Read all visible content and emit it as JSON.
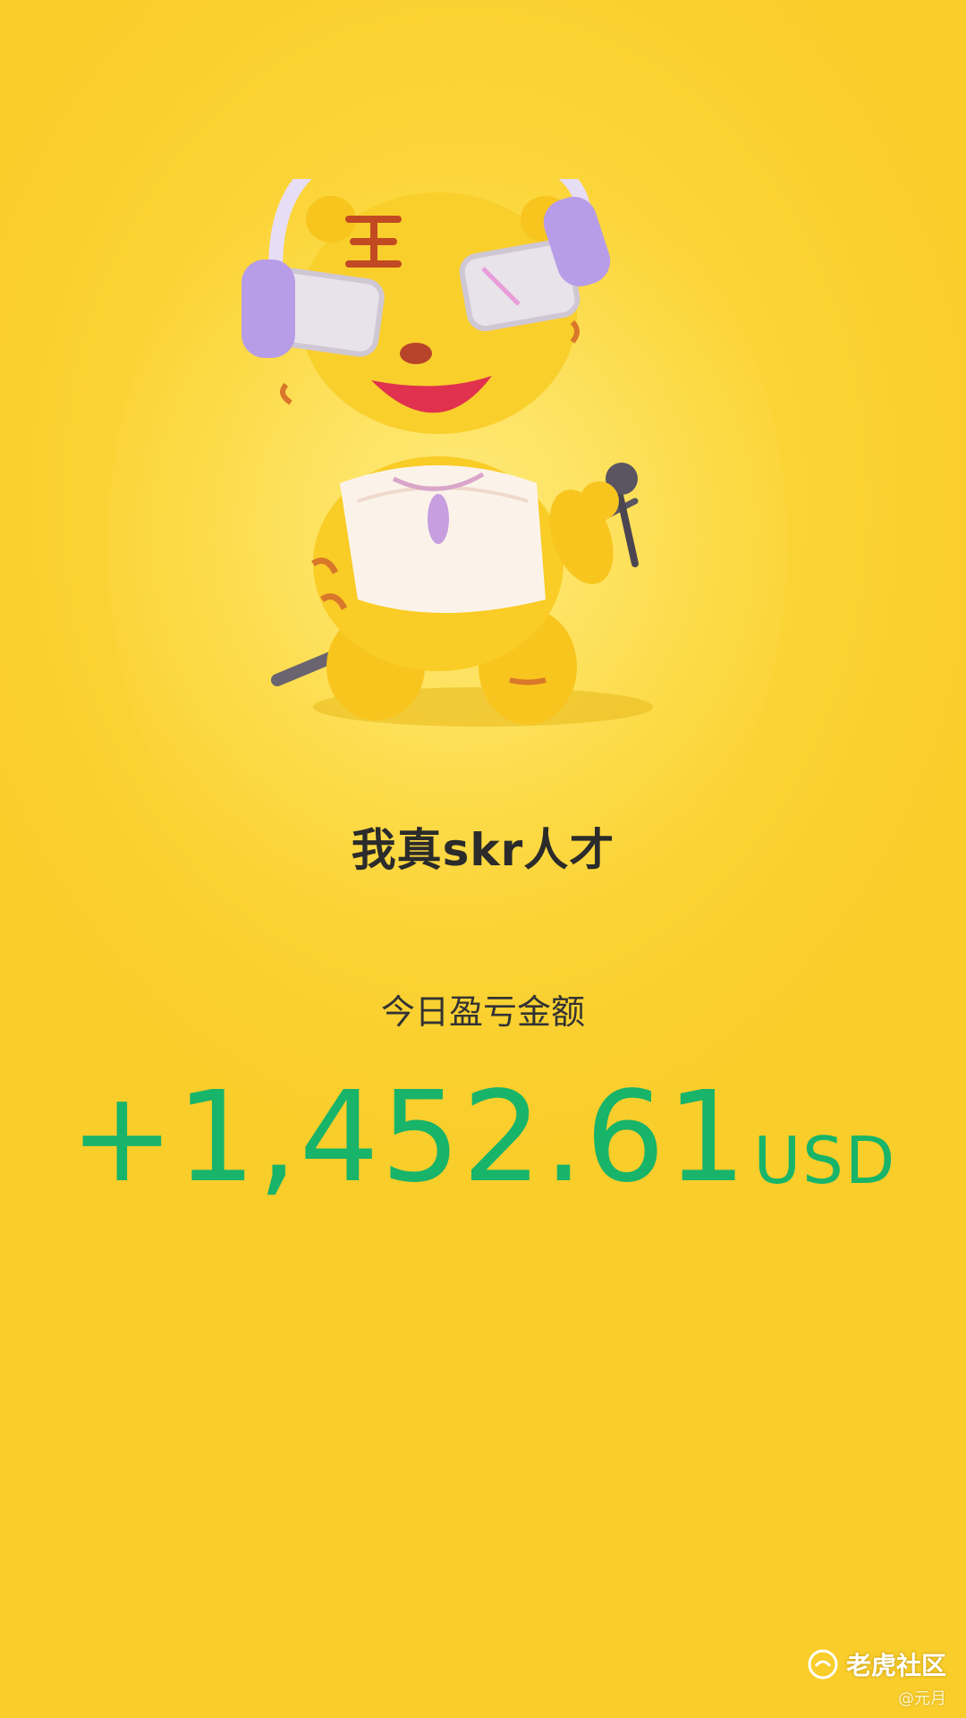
{
  "title": "我真skr人才",
  "pnl_label": "今日盈亏金额",
  "pnl_amount": "+1,452.61",
  "currency": "USD",
  "watermark": {
    "brand": "老虎社区",
    "author": "@元月"
  },
  "colors": {
    "background": "#fcd63a",
    "profit_green": "#17b46a",
    "title_text": "#2b2b2b"
  },
  "mascot": {
    "icon": "tiger-mascot-singing-icon",
    "forehead_mark": "王"
  }
}
